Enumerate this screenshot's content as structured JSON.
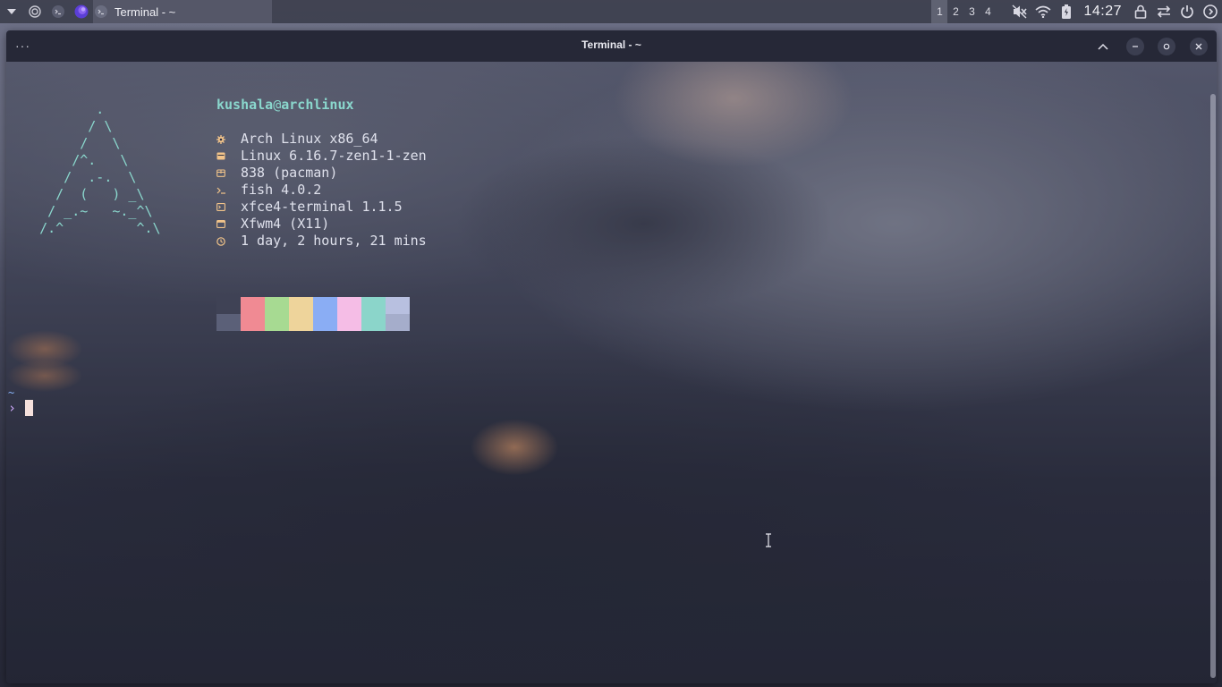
{
  "panel": {
    "icons": [
      "whisker-menu-icon",
      "target-icon",
      "terminal-icon",
      "browser-icon"
    ],
    "task": {
      "label": "Terminal - ~"
    },
    "workspaces": [
      "1",
      "2",
      "3",
      "4"
    ],
    "active_workspace": "1",
    "tray": [
      "volume-muted-icon",
      "wifi-icon",
      "battery-icon"
    ],
    "clock": "14:27",
    "actions": [
      "lock-icon",
      "switch-user-icon",
      "power-icon",
      "logout-icon"
    ]
  },
  "window": {
    "title": "Terminal - ~",
    "menu": "···"
  },
  "terminal": {
    "user": "kushala",
    "at": "@",
    "host": "archlinux",
    "info": [
      {
        "icon": "arch-gear-icon",
        "value": "Arch Linux x86_64"
      },
      {
        "icon": "kernel-icon",
        "value": "Linux 6.16.7-zen1-1-zen"
      },
      {
        "icon": "package-icon",
        "value": "838 (pacman)"
      },
      {
        "icon": "shell-icon",
        "value": "fish 4.0.2"
      },
      {
        "icon": "terminal-icon",
        "value": "xfce4-terminal 1.1.5"
      },
      {
        "icon": "window-manager-icon",
        "value": "Xfwm4 (X11)"
      },
      {
        "icon": "clock-icon",
        "value": "1 day, 2 hours, 21 mins"
      }
    ],
    "palette_top": [
      "#3f4255",
      "#f08a93",
      "#a7da92",
      "#eed49b",
      "#8aadf4",
      "#f5bde6",
      "#8bd5ca",
      "#b8c0e0"
    ],
    "palette_bottom": [
      "#5b6078",
      "#f08a93",
      "#a7da92",
      "#eed49b",
      "#8aadf4",
      "#f5bde6",
      "#8bd5ca",
      "#a5adcb"
    ],
    "prompt_dir": "~",
    "prompt_symbol": "›"
  },
  "colors": {
    "accent": "#8ad7cd",
    "icon": "#f2c48a",
    "text": "#dfe1ec",
    "prompt": "#cba6f7",
    "cursor": "#f5e0dc"
  }
}
